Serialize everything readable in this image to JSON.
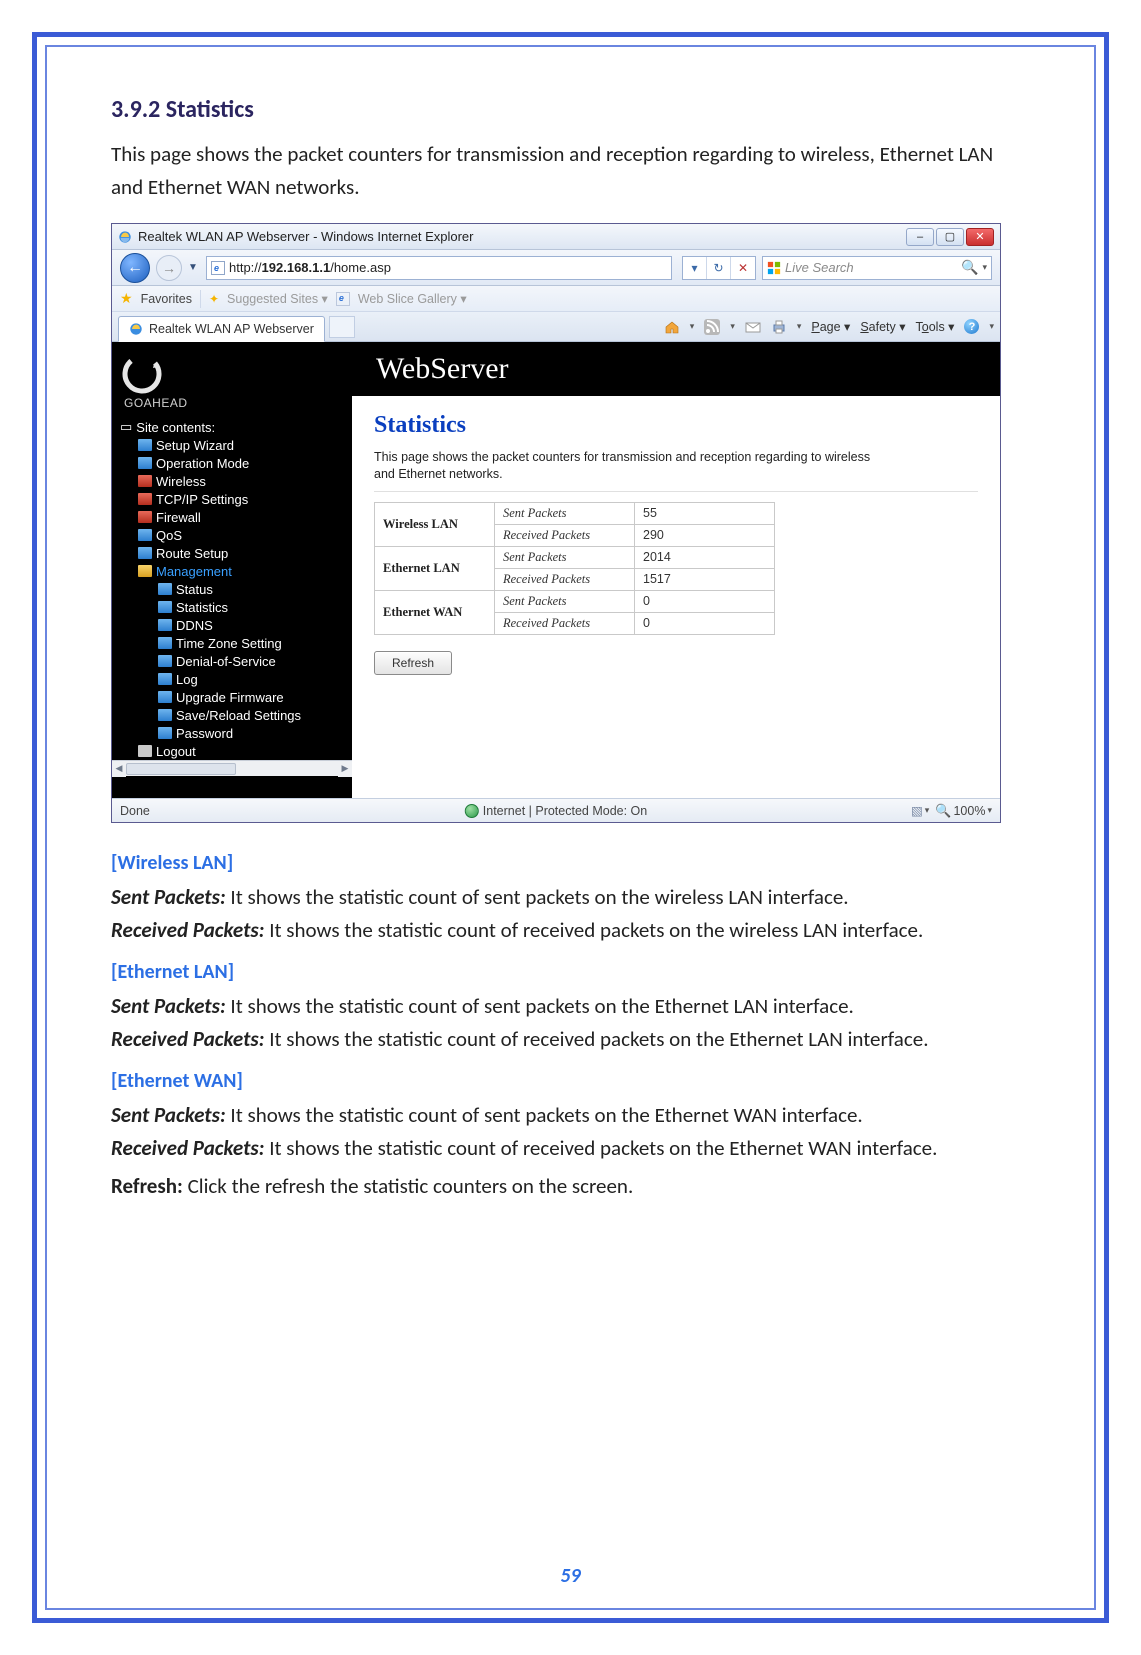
{
  "doc": {
    "heading": "3.9.2    Statistics",
    "intro": "This page shows the packet counters for transmission and reception regarding to wireless, Ethernet LAN and Ethernet WAN networks.",
    "sec_wlan_h": "[Wireless LAN]",
    "sec_wlan_sent_l": "Sent Packets:",
    "sec_wlan_sent_t": " It shows the statistic count of sent packets on the wireless LAN interface.",
    "sec_wlan_recv_l": "Received Packets:",
    "sec_wlan_recv_t": " It shows the statistic count of received packets on the wireless LAN interface.",
    "sec_elan_h": "[Ethernet LAN]",
    "sec_elan_sent_l": "Sent Packets:",
    "sec_elan_sent_t": " It shows the statistic count of sent packets on the Ethernet LAN interface.",
    "sec_elan_recv_l": "Received Packets:",
    "sec_elan_recv_t": " It shows the statistic count of received packets on the Ethernet LAN interface.",
    "sec_ewan_h": "[Ethernet WAN]",
    "sec_ewan_sent_l": "Sent Packets:",
    "sec_ewan_sent_t": " It shows the statistic count of sent packets on the Ethernet WAN interface.",
    "sec_ewan_recv_l": "Received Packets:",
    "sec_ewan_recv_t": " It shows the statistic count of received packets on the Ethernet WAN interface.",
    "sec_refresh_l": "Refresh:",
    "sec_refresh_t": " Click the refresh the statistic counters on the screen.",
    "page_num": "59"
  },
  "browser": {
    "title": "Realtek WLAN AP Webserver - Windows Internet Explorer",
    "win_min": "–",
    "win_max": "▢",
    "win_close": "✕",
    "back_glyph": "←",
    "fwd_glyph": "→",
    "nav_drop": "▼",
    "addr_prefix": "http://",
    "addr_host": "192.168.1.1",
    "addr_path": "/home.asp",
    "triplet_drop": "▾",
    "triplet_refresh": "↻",
    "triplet_stop": "✕",
    "search_placeholder": "Live Search",
    "mag_glyph": "🔍",
    "fav_label": "Favorites",
    "suggested": "Suggested Sites ▾",
    "webslice": "Web Slice Gallery ▾",
    "tab_label": "Realtek WLAN AP Webserver",
    "cmd_page": "Page ▾",
    "cmd_safety": "Safety ▾",
    "cmd_tools": "Tools ▾",
    "status_done": "Done",
    "status_mode": "Internet | Protected Mode: On",
    "status_zoom": "100%"
  },
  "ws": {
    "brand": "WebServer",
    "goahead": "GOAHEAD",
    "tree": {
      "root": "Site contents:",
      "setupwiz": "Setup Wizard",
      "opmode": "Operation Mode",
      "wireless": "Wireless",
      "tcpip": "TCP/IP Settings",
      "firewall": "Firewall",
      "qos": "QoS",
      "route": "Route Setup",
      "management": "Management",
      "status": "Status",
      "statistics": "Statistics",
      "ddns": "DDNS",
      "tz": "Time Zone Setting",
      "dos": "Denial-of-Service",
      "log": "Log",
      "upgrade": "Upgrade Firmware",
      "save": "Save/Reload Settings",
      "password": "Password",
      "logout": "Logout"
    },
    "page": {
      "title": "Statistics",
      "desc": "This page shows the packet counters for transmission and reception regarding to wireless and Ethernet networks.",
      "wlan": "Wireless LAN",
      "elan": "Ethernet LAN",
      "ewan": "Ethernet WAN",
      "sent": "Sent Packets",
      "recv": "Received Packets",
      "wlan_sent": "55",
      "wlan_recv": "290",
      "elan_sent": "2014",
      "elan_recv": "1517",
      "ewan_sent": "0",
      "ewan_recv": "0",
      "refresh": "Refresh"
    }
  }
}
